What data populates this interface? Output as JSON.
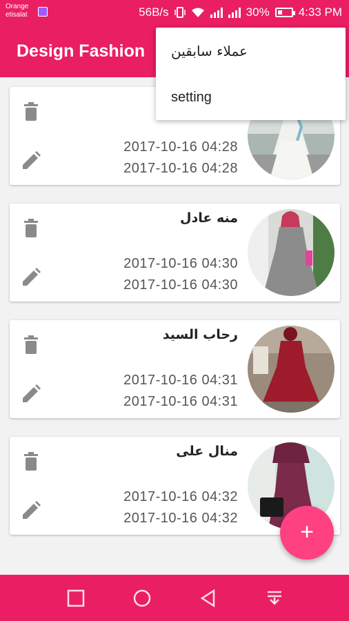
{
  "status_bar": {
    "carrier_line1": "Orange",
    "carrier_line2": "etisalat",
    "speed": "56B/s",
    "battery": "30%",
    "time": "4:33 PM"
  },
  "app_bar": {
    "title": "Design Fashion"
  },
  "menu": {
    "items": [
      "عملاء سابقين",
      "setting"
    ]
  },
  "cards": [
    {
      "name": "",
      "date1": "2017-10-16  04:28",
      "date2": "2017-10-16  04:28",
      "photo_icon": "white-dress-photo"
    },
    {
      "name": "منه عادل",
      "date1": "2017-10-16  04:30",
      "date2": "2017-10-16  04:30",
      "photo_icon": "grey-dress-photo"
    },
    {
      "name": "رحاب السيد",
      "date1": "2017-10-16  04:31",
      "date2": "2017-10-16  04:31",
      "photo_icon": "red-dress-photo"
    },
    {
      "name": "منال على",
      "date1": "2017-10-16  04:32",
      "date2": "2017-10-16  04:32",
      "photo_icon": "maroon-dress-photo"
    }
  ],
  "fab": {
    "label": "+"
  },
  "colors": {
    "primary": "#e91e63",
    "accent": "#ff4081",
    "icon_grey": "#8a8a8a"
  }
}
